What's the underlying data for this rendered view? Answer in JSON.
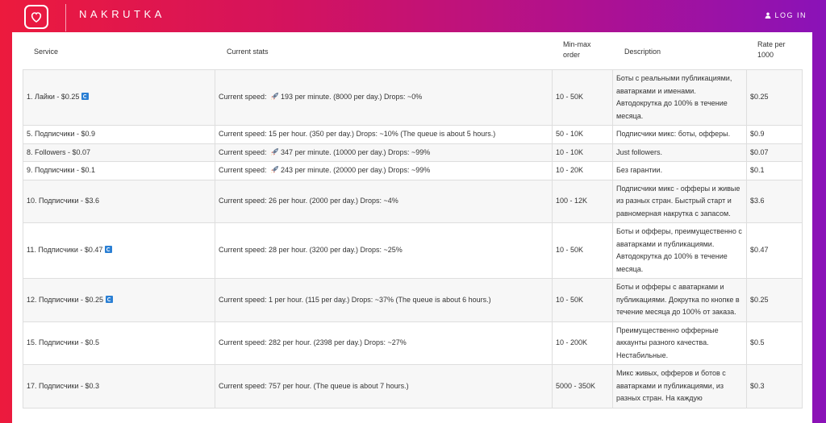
{
  "header": {
    "brand": "NAKRUTKA",
    "login_label": "LOG IN"
  },
  "table": {
    "columns": {
      "service": "Service",
      "stats": "Current stats",
      "minmax_line1": "Min-max",
      "minmax_line2": "order",
      "description": "Description",
      "rate_line1": "Rate per",
      "rate_line2": "1000"
    },
    "rows": [
      {
        "service": "1. Лайки - $0.25",
        "refresh": true,
        "stats_pre": "Current speed: ",
        "rocket": true,
        "stats": "193 per minute. (8000 per day.) Drops: ~0%",
        "minmax": "10 - 50K",
        "description": "Боты с реальными публикациями, аватарками и именами. Автодокрутка до 100% в течение месяца.",
        "rate": "$0.25"
      },
      {
        "service": "5. Подписчики - $0.9",
        "refresh": false,
        "stats_pre": "Current speed: ",
        "rocket": false,
        "stats": "15 per hour. (350 per day.) Drops: ~10% (The queue is about 5 hours.)",
        "minmax": "50 - 10K",
        "description": "Подписчики микс: боты, офферы.",
        "rate": "$0.9"
      },
      {
        "service": "8. Followers - $0.07",
        "refresh": false,
        "stats_pre": "Current speed: ",
        "rocket": true,
        "stats": "347 per minute. (10000 per day.) Drops: ~99%",
        "minmax": "10 - 10K",
        "description": "Just followers.",
        "rate": "$0.07"
      },
      {
        "service": "9. Подписчики - $0.1",
        "refresh": false,
        "stats_pre": "Current speed: ",
        "rocket": true,
        "stats": "243 per minute. (20000 per day.) Drops: ~99%",
        "minmax": "10 - 20K",
        "description": "Без гарантии.",
        "rate": "$0.1"
      },
      {
        "service": "10. Подписчики - $3.6",
        "refresh": false,
        "stats_pre": "Current speed: ",
        "rocket": false,
        "stats": "26 per hour. (2000 per day.) Drops: ~4%",
        "minmax": "100 - 12K",
        "description": "Подписчики микс - офферы и живые из разных стран. Быстрый старт и равномерная накрутка с запасом.",
        "rate": "$3.6"
      },
      {
        "service": "11. Подписчики - $0.47",
        "refresh": true,
        "stats_pre": "Current speed: ",
        "rocket": false,
        "stats": "28 per hour. (3200 per day.) Drops: ~25%",
        "minmax": "10 - 50K",
        "description": "Боты и офферы, преимущественно с аватарками и публикациями. Автодокрутка до 100% в течение месяца.",
        "rate": "$0.47"
      },
      {
        "service": "12. Подписчики - $0.25",
        "refresh": true,
        "stats_pre": "Current speed: ",
        "rocket": false,
        "stats": "1 per hour. (115 per day.) Drops: ~37% (The queue is about 6 hours.)",
        "minmax": "10 - 50K",
        "description": "Боты и офферы с аватарками и публикациями. Докрутка по кнопке в течение месяца до 100% от заказа.",
        "rate": "$0.25"
      },
      {
        "service": "15. Подписчики - $0.5",
        "refresh": false,
        "stats_pre": "Current speed: ",
        "rocket": false,
        "stats": "282 per hour. (2398 per day.) Drops: ~27%",
        "minmax": "10 - 200K",
        "description": "Преимущественно офферные аккаунты разного качества. Нестабильные.",
        "rate": "$0.5"
      },
      {
        "service": "17. Подписчики - $0.3",
        "refresh": false,
        "stats_pre": "Current speed: ",
        "rocket": false,
        "stats": "757 per hour. (The queue is about 7 hours.)",
        "minmax": "5000 - 350K",
        "description": "Микс живых, офферов и ботов с аватарками и публикациями, из разных стран. На каждую",
        "rate": "$0.3"
      }
    ]
  }
}
